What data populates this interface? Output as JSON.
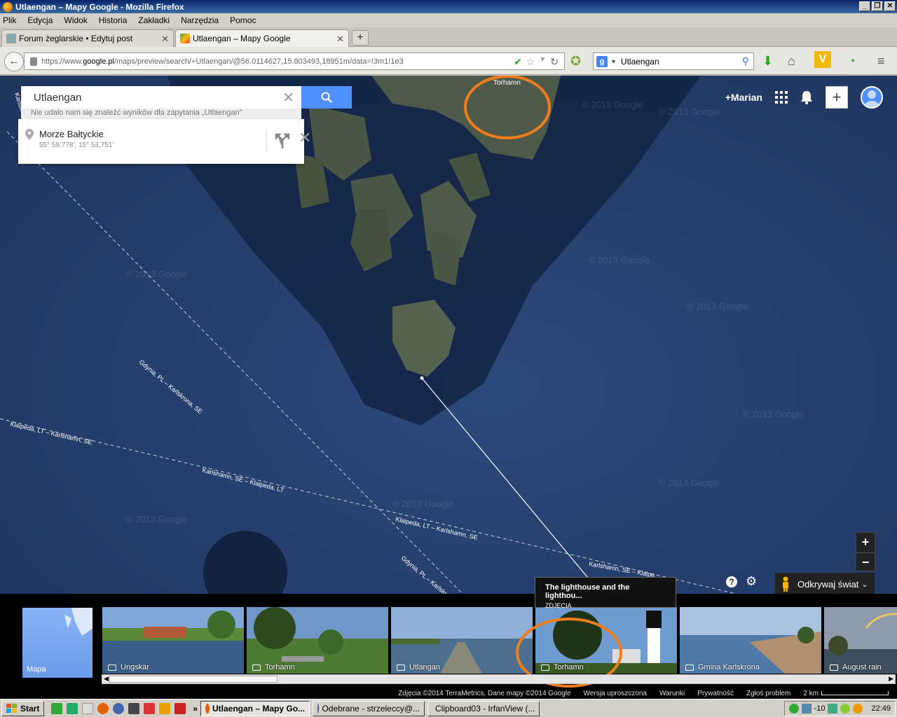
{
  "window": {
    "title": "Utlaengan – Mapy Google - Mozilla Firefox"
  },
  "menu": [
    "Plik",
    "Edycja",
    "Widok",
    "Historia",
    "Zakładki",
    "Narzędzia",
    "Pomoc"
  ],
  "tabs": [
    {
      "label": "Forum żeglarskie • Edytuj post"
    },
    {
      "label": "Utlaengan – Mapy Google"
    }
  ],
  "url": {
    "prefix": "https://www.",
    "domain": "google.pl",
    "path": "/maps/preview/search/+Utlaengan/@56.0114627,15.803493,18951m/data=!3m1!1e3"
  },
  "browser_search": {
    "value": "Utlaengan"
  },
  "maps": {
    "search_value": "Utlaengan",
    "no_result": "Nie udało nam się znaleźć wyników dla zapytania „Utlaengan”",
    "place_name": "Morze Bałtyckie",
    "place_coords": "55° 59.778', 15° 53.751'",
    "user": "+Marian",
    "explore": "Odkrywaj świat",
    "zoom_in": "+",
    "zoom_out": "−",
    "tooltip_title": "The lighthouse and the lighthou...",
    "tooltip_sub": "ZDJĘCIA"
  },
  "map_labels": {
    "torhamn": "Torhamn",
    "karlskrona_se": "Karlskrona, SE",
    "gdynia1": "Gdynia, PL – Karlskrona, SE",
    "klaipeda1": "Klaipeda, LT – Karlshamn, SE",
    "karlshamn1": "Karlshamn, SE – Klaipeda, LT",
    "klaipeda2": "Klaipeda, LT – Karlshamn, SE",
    "gdynia2": "Gdynia, PL – Karlskro...",
    "karlshamn2": "Karlshamn, SE – Klaipe..."
  },
  "watermark": "© 2013 Google",
  "photos": [
    {
      "label": "Mapa"
    },
    {
      "label": "Ungskär"
    },
    {
      "label": "Torhamn"
    },
    {
      "label": "Utlangan"
    },
    {
      "label": "Torhamn"
    },
    {
      "label": "Gmina Karlskrona"
    },
    {
      "label": "August rain"
    }
  ],
  "footer": {
    "copyright": "Zdjęcia ©2014 TerraMetrics, Dane mapy ©2014 Google",
    "lite": "Wersja uproszczona",
    "terms": "Warunki",
    "privacy": "Prywatność",
    "report": "Zgłoś problem",
    "scale": "2 km"
  },
  "taskbar": {
    "start": "Start",
    "tasks": [
      "Utlaengan – Mapy Go...",
      "Odebrane - strzeleccy@...",
      "Clipboard03 - IrfanView (..."
    ],
    "tray_temp": "-10",
    "clock": "22:49"
  },
  "colors": {
    "accent": "#4d90fe",
    "highlight_circle": "#f07d1a"
  }
}
